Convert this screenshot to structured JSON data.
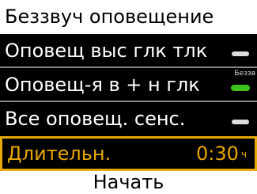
{
  "header": {
    "title": "Беззвуч оповещение"
  },
  "rows": [
    {
      "label": "Оповещ выс глк тлк",
      "toggle": false
    },
    {
      "label": "Оповещ-я в + н глк",
      "toggle": true,
      "toggle_tag": "Беззв"
    },
    {
      "label": "Все оповещ. сенс.",
      "toggle": false
    }
  ],
  "duration": {
    "label": "Длительн.",
    "value": "0:30",
    "unit": "ч"
  },
  "action": {
    "label": "Начать"
  },
  "colors": {
    "selected": "#e7a800",
    "toggle_on": "#3ec21b"
  }
}
